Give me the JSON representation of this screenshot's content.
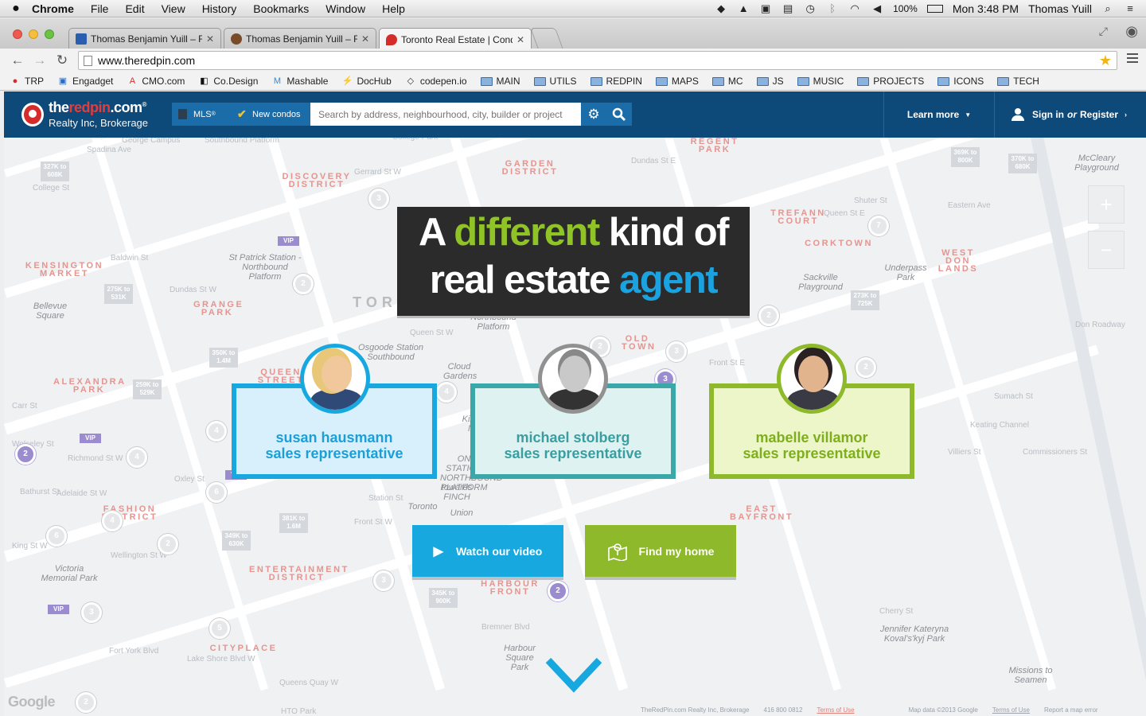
{
  "menubar": {
    "apple": "",
    "app": "Chrome",
    "items": [
      "File",
      "Edit",
      "View",
      "History",
      "Bookmarks",
      "Window",
      "Help"
    ],
    "battery": "100%",
    "clock": "Mon 3:48 PM",
    "user": "Thomas Yuill"
  },
  "tabs": [
    {
      "title": "Thomas Benjamin Yuill – F",
      "active": false,
      "fav_color": "#2a5fb0"
    },
    {
      "title": "Thomas Benjamin Yuill – F",
      "active": false,
      "fav_color": "#7a4b2a"
    },
    {
      "title": "Toronto Real Estate | Cond",
      "active": true,
      "fav_color": "#d52b2b"
    }
  ],
  "toolbar": {
    "url": "www.theredpin.com"
  },
  "bookmarks": [
    {
      "label": "TRP",
      "icon": "pin-icon"
    },
    {
      "label": "Engadget",
      "icon": "engadget-icon"
    },
    {
      "label": "CMO.com",
      "icon": "adobe-icon"
    },
    {
      "label": "Co.Design",
      "icon": "codesign-icon"
    },
    {
      "label": "Mashable",
      "icon": "mashable-icon"
    },
    {
      "label": "DocHub",
      "icon": "bolt-icon"
    },
    {
      "label": "codepen.io",
      "icon": "codepen-icon"
    },
    {
      "label": "MAIN",
      "icon": "folder-icon"
    },
    {
      "label": "UTILS",
      "icon": "folder-icon"
    },
    {
      "label": "REDPIN",
      "icon": "folder-icon"
    },
    {
      "label": "MAPS",
      "icon": "folder-icon"
    },
    {
      "label": "MC",
      "icon": "folder-icon"
    },
    {
      "label": "JS",
      "icon": "folder-icon"
    },
    {
      "label": "MUSIC",
      "icon": "folder-icon"
    },
    {
      "label": "PROJECTS",
      "icon": "folder-icon"
    },
    {
      "label": "ICONS",
      "icon": "folder-icon"
    },
    {
      "label": "TECH",
      "icon": "folder-icon"
    }
  ],
  "site": {
    "logo_the": "the",
    "logo_red": "redpin",
    "logo_com": ".com",
    "logo_reg": "®",
    "logo_sub": "Realty Inc, Brokerage",
    "mls_label": "MLS",
    "mls_sup": "®",
    "condos_label": "New condos",
    "search_placeholder": "Search by address, neighbourhood, city, builder or project",
    "learn_more": "Learn more",
    "sign_in": "Sign in",
    "or": "or",
    "register": "Register"
  },
  "hero": {
    "line1_a": "A ",
    "line1_b": "different",
    "line1_c": " kind of",
    "line2_a": "real estate ",
    "line2_b": "agent",
    "colors": {
      "green": "#8fc326",
      "blue": "#1aa3e0"
    }
  },
  "agents": [
    {
      "name": "susan hausmann",
      "role": "sales representative",
      "color": "#18a8e0",
      "bg": "#d8f0fb",
      "text": "#1b9fd6"
    },
    {
      "name": "michael stolberg",
      "role": "sales representative",
      "color": "#3aa8a8",
      "bg": "#dff2f2",
      "text": "#3a9ea0"
    },
    {
      "name": "mabelle villamor",
      "role": "sales representative",
      "color": "#8db92a",
      "bg": "#ecf6c9",
      "text": "#7fae1c"
    }
  ],
  "buttons": {
    "video": "Watch our video",
    "find": "Find my home"
  },
  "map": {
    "districts": [
      "DISCOVERY DISTRICT",
      "GARDEN DISTRICT",
      "REGENT PARK",
      "TREFANN COURT",
      "CORKTOWN",
      "WEST DON LANDS",
      "KENSINGTON MARKET",
      "GRANGE PARK",
      "ALEXANDRA PARK",
      "QUEEN STREET",
      "OLD TOWN",
      "FASHION DISTRICT",
      "ENTERTAINMENT DISTRICT",
      "HARBOUR FRONT",
      "EAST BAYFRONT",
      "CITYPLACE",
      "TORO"
    ],
    "streets": [
      "George Campus",
      "Southbound Platform",
      "College Park",
      "Gerrard St W",
      "Dundas St E",
      "Queen St E",
      "Eastern Ave",
      "College St",
      "Baldwin St",
      "Dundas St W",
      "Queen St W",
      "Richmond St W",
      "Adelaide St W",
      "King St W",
      "Front St W",
      "Wellington St W",
      "Spadina Ave",
      "Bathurst St",
      "Lake Shore Blvd W",
      "Queens Quay W",
      "Fort York Blvd",
      "Bremner Blvd",
      "Commissioners St",
      "Cherry St",
      "Carr St",
      "Wolseley St",
      "Oxley St",
      "Front St E",
      "Shuter St",
      "Sumach St",
      "Keating Channel",
      "Villiers St",
      "Don Roadway",
      "Station St",
      "HTO Park"
    ],
    "places": [
      "St Patrick Station - Northbound Platform",
      "Bellevue Square",
      "Victoria Memorial Park",
      "Cloud Gardens",
      "Sackville Playground",
      "Underpass Park",
      "McCleary Playground",
      "Harbour Square Park",
      "Jennifer Kateryna Koval's'kyj Park",
      "Missions to Seamen",
      "Northbound Platform",
      "Osgoode Station Southbound",
      "Union",
      "Toronto",
      "towards FINCH",
      "ON STATION NORTHBOUND PLATFORM",
      "King - No"
    ],
    "prices": [
      "327K to 608K",
      "275K to 531K",
      "350K to 1.4M",
      "259K to 529K",
      "349K to 630K",
      "381K to 1.6M",
      "345K to 900K",
      "369K to 800K",
      "370K to 680K",
      "273K to 725K"
    ],
    "clusters": [
      "3",
      "2",
      "7",
      "2",
      "2",
      "3",
      "2",
      "2",
      "4",
      "4",
      "6",
      "4",
      "6",
      "2",
      "3",
      "3",
      "5",
      "2",
      "2",
      "4",
      "3"
    ],
    "vip": "VIP",
    "zoom_in": "+",
    "zoom_out": "−",
    "google": "Google",
    "footer": [
      "TheRedPin.com Realty Inc, Brokerage",
      "416 800 0812",
      "Terms of Use",
      "Map data ©2013 Google",
      "Terms of Use",
      "Report a map error"
    ]
  }
}
